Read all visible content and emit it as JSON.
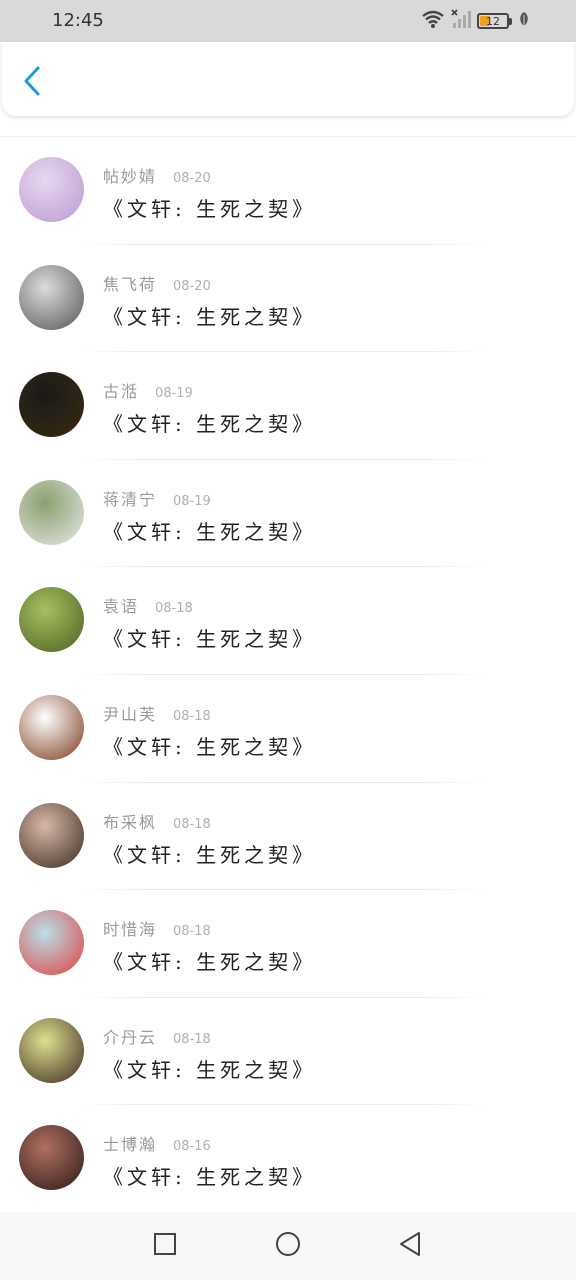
{
  "status_bar": {
    "time": "12:45",
    "battery_level": "12",
    "icons": [
      "wifi-icon",
      "cellular-signal-icon",
      "battery-icon",
      "leaf-icon"
    ]
  },
  "header": {
    "back_icon": "chevron-left-icon",
    "accent_color": "#1a9be6"
  },
  "messages": [
    {
      "name": "帖妙婧",
      "date": "08-20",
      "text": "《文轩: 生死之契》",
      "avatar_colors": [
        "#e8d8f0",
        "#b89ad0"
      ]
    },
    {
      "name": "焦飞荷",
      "date": "08-20",
      "text": "《文轩: 生死之契》",
      "avatar_colors": [
        "#dcdcdc",
        "#555555"
      ]
    },
    {
      "name": "古湉",
      "date": "08-19",
      "text": "《文轩: 生死之契》",
      "avatar_colors": [
        "#1a1a1a",
        "#3a2a10"
      ]
    },
    {
      "name": "蒋清宁",
      "date": "08-19",
      "text": "《文轩: 生死之契》",
      "avatar_colors": [
        "#8aa070",
        "#e8e8e8"
      ]
    },
    {
      "name": "袁语",
      "date": "08-18",
      "text": "《文轩: 生死之契》",
      "avatar_colors": [
        "#a8c060",
        "#4a6020"
      ]
    },
    {
      "name": "尹山芙",
      "date": "08-18",
      "text": "《文轩: 生死之契》",
      "avatar_colors": [
        "#ffffff",
        "#7a3a1a"
      ]
    },
    {
      "name": "布采枫",
      "date": "08-18",
      "text": "《文轩: 生死之契》",
      "avatar_colors": [
        "#d8b8a8",
        "#3a2a20"
      ]
    },
    {
      "name": "时惜海",
      "date": "08-18",
      "text": "《文轩: 生死之契》",
      "avatar_colors": [
        "#b8e0e8",
        "#e04040"
      ]
    },
    {
      "name": "介丹云",
      "date": "08-18",
      "text": "《文轩: 生死之契》",
      "avatar_colors": [
        "#e0e090",
        "#3a2a20"
      ]
    },
    {
      "name": "士博瀚",
      "date": "08-16",
      "text": "《文轩: 生死之契》",
      "avatar_colors": [
        "#b07060",
        "#2a1a18"
      ]
    }
  ],
  "nav_bar": {
    "icons": [
      "recent-apps-icon",
      "home-icon",
      "back-triangle-icon"
    ]
  }
}
